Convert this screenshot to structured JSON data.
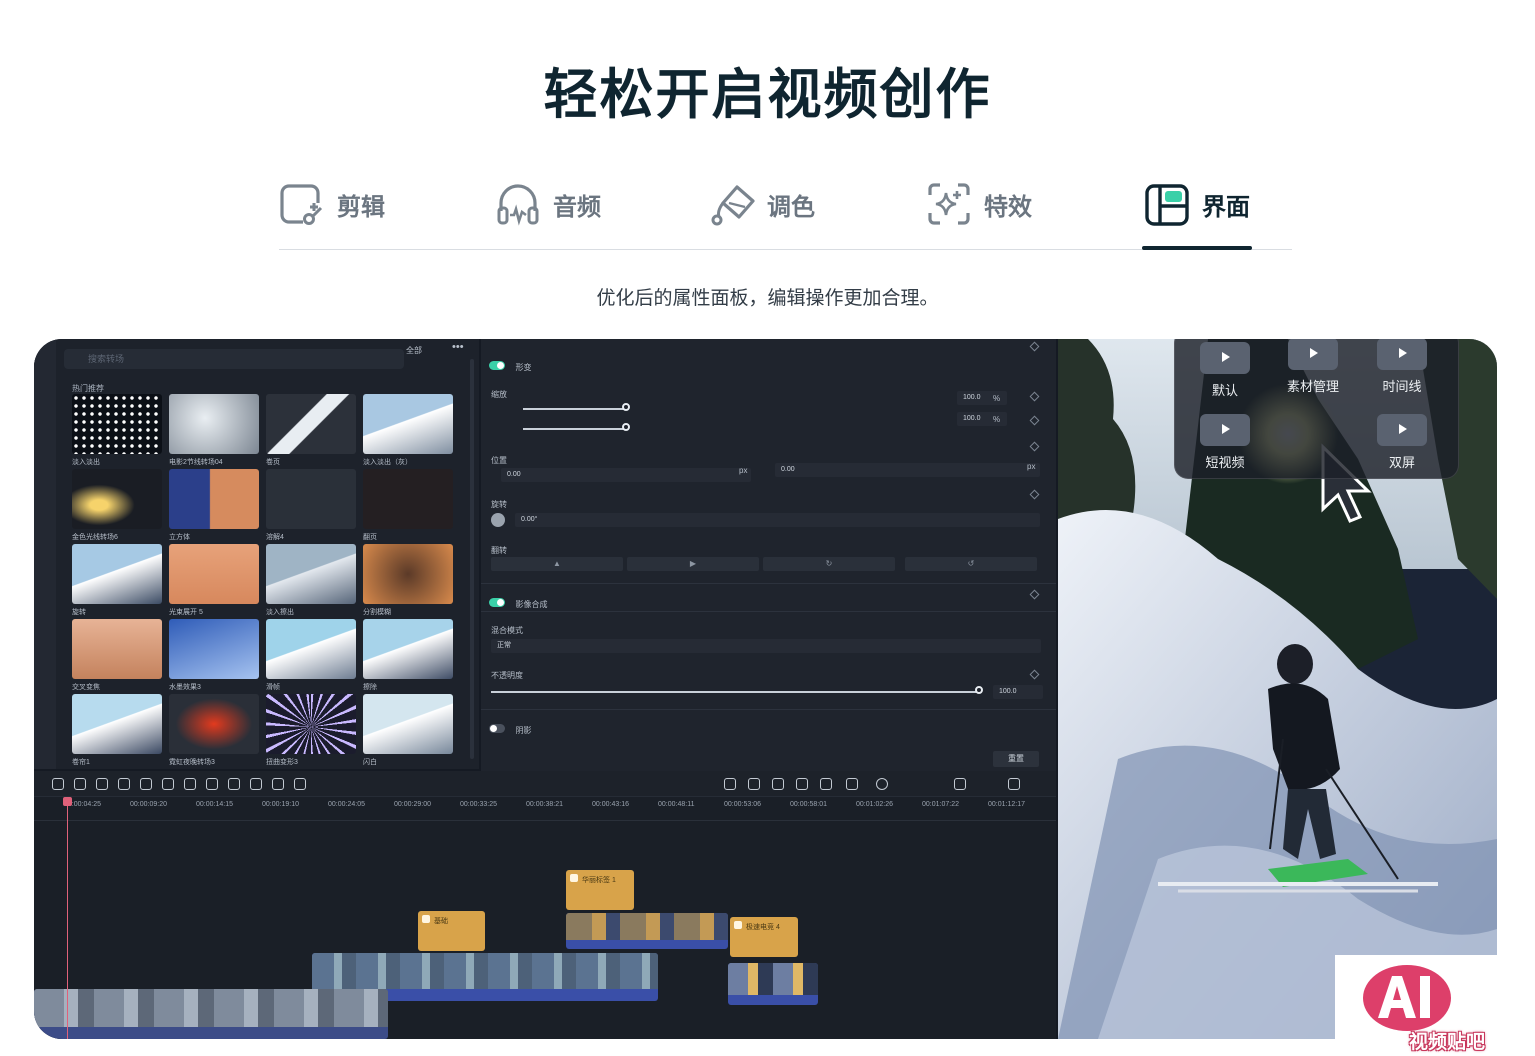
{
  "hero": {
    "title": "轻松开启视频创作"
  },
  "tabs": [
    {
      "label": "剪辑",
      "icon": "edit-clip-icon",
      "active": false
    },
    {
      "label": "音频",
      "icon": "headphones-icon",
      "active": false
    },
    {
      "label": "调色",
      "icon": "paint-bucket-icon",
      "active": false
    },
    {
      "label": "特效",
      "icon": "sparkle-frame-icon",
      "active": false
    },
    {
      "label": "界面",
      "icon": "layout-panels-icon",
      "active": true
    }
  ],
  "subtitle": "优化后的属性面板，编辑操作更加合理。",
  "colors": {
    "title": "#0f2530",
    "accent_toggle": "#3ad0a8",
    "clip_title": "#d8a34a",
    "clip_video": "#3a4fa8",
    "playhead": "#e0617a"
  },
  "app": {
    "media": {
      "search_placeholder": "搜索转场",
      "filter": "全部",
      "more": "•••",
      "section": "热门推荐",
      "items": [
        "淡入淡出",
        "电影2节线转场04",
        "卷页",
        "淡入淡出（灰）",
        "金色光线转场6",
        "立方体",
        "溶解4",
        "翻页",
        "旋转",
        "光束展开 5",
        "淡入擦出",
        "分割模糊",
        "交叉变焦",
        "水墨效果3",
        "滑帧",
        "擦除",
        "卷帘1",
        "霓虹夜晚转场3",
        "扭曲变形3",
        "闪白"
      ]
    },
    "props": {
      "transform": "形变",
      "scale": "缩放",
      "scale_x": "100.0",
      "scale_y": "100.0",
      "unit_pct": "%",
      "position": "位置",
      "pos_x": "0.00",
      "pos_y": "0.00",
      "unit_px": "px",
      "rotate": "旋转",
      "rotate_val": "0.00°",
      "flip": "翻转",
      "compositing": "影像合成",
      "blend_mode": "混合模式",
      "blend_value": "正常",
      "opacity": "不透明度",
      "opacity_val": "100.0",
      "shadow": "阴影",
      "reset": "重置"
    },
    "layout_menu": [
      {
        "label": "默认"
      },
      {
        "label": "素材管理"
      },
      {
        "label": "时间线"
      },
      {
        "label": "短视频"
      },
      {
        "label": "双屏"
      }
    ],
    "timeline": {
      "ticks": [
        "00:00:04:25",
        "00:00:09:20",
        "00:00:14:15",
        "00:00:19:10",
        "00:00:24:05",
        "00:00:29:00",
        "00:00:33:25",
        "00:00:38:21",
        "00:00:43:16",
        "00:00:48:11",
        "00:00:53:06",
        "00:00:58:01",
        "00:01:02:26",
        "00:01:07:22",
        "00:01:12:17"
      ],
      "title_clips": [
        "基础",
        "华丽标签 1",
        "极速电竞 4"
      ]
    }
  },
  "watermark": {
    "logo": "AI",
    "text": "视频贴吧"
  }
}
